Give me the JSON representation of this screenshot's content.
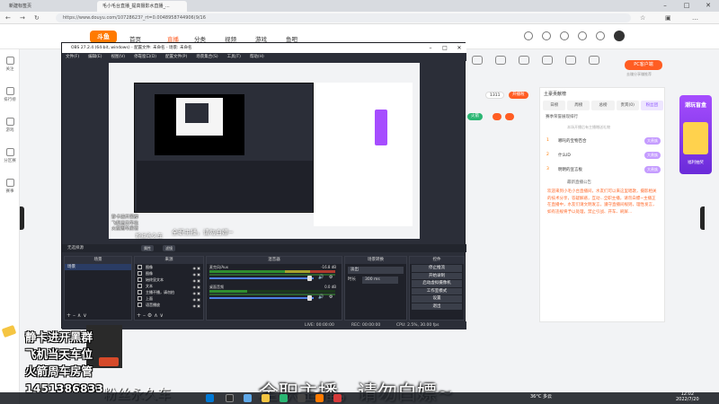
{
  "browser": {
    "tabs": [
      "新建标签页",
      "毛小毛台直播_提高摄影水直播_..."
    ],
    "url": "https://www.douyu.com/10728623?_rt=0.0048958744906(9/16"
  },
  "site": {
    "logo": "斗鱼",
    "nav": [
      "首页",
      "直播",
      "分类",
      "视频",
      "游戏",
      "鱼吧"
    ],
    "rail": [
      "关注",
      "排行榜",
      "游戏",
      "分区赛",
      "赛事"
    ],
    "room_actions": [
      "",
      "",
      "",
      "",
      "",
      "",
      ""
    ],
    "pc_button": "PC客户端",
    "pc_sub": "去赚分享赚推荐",
    "stat_num": "1311",
    "stat_pill": "开播啦",
    "fire": "火箭"
  },
  "rank": {
    "header": "土豪贡献榜",
    "tabs": [
      "日榜",
      "周榜",
      "总榜",
      "贵宾(0)",
      "粉丝团"
    ],
    "subtitle": "赛季荣誉展现排行",
    "subtitle2": "本场开播后有主播赠送礼物",
    "rows": [
      {
        "n": "1",
        "name": "哪吒的宝物百合",
        "tag": "大贵族"
      },
      {
        "n": "2",
        "name": "什么ID",
        "tag": "大贵族"
      },
      {
        "n": "3",
        "name": "明明的宣言板",
        "tag": "大贵族"
      }
    ],
    "notice_title": "最新直播公告",
    "notice": "欢迎来到小毛小台直播间，水友们可以来这里唱歌，摄影相关的技术分享，答疑解惑，互动...全职主播，请勿白嫖~主播正在直播中，水友们请文明发言，遵守直播间规则，理性发言，如有违规将予以处理，禁止引战、开车、刷屏..."
  },
  "ad": {
    "title": "潮玩盲盒",
    "sub": "福利抽奖"
  },
  "obs": {
    "title": "OBS 27.2.4 (64-bit, windows) - 配置文件: 未命名 - 场景: 未命名",
    "menu": [
      "文件(F)",
      "编辑(E)",
      "视图(V)",
      "停靠窗口(D)",
      "配置文件(P)",
      "场景集合(S)",
      "工具(T)",
      "帮助(H)"
    ],
    "underbar": "无选择源",
    "props_btn": "属性",
    "filter_btn": "滤镜",
    "docks": {
      "scenes": "场景",
      "sources": "来源",
      "mixer": "混音器",
      "transitions": "场景转换",
      "controls": "控件"
    },
    "scene_items": [
      "场景"
    ],
    "source_items": [
      "图像",
      "图像",
      "始终显文本",
      "文本",
      "主播不播，请勿拍",
      "上面",
      "语音播放"
    ],
    "mixer": [
      {
        "name": "麦克风/Aux",
        "db": "-16.8 dB"
      },
      {
        "name": "桌面音频",
        "db": "0.0 dB"
      }
    ],
    "transition": {
      "type": "淡出",
      "duration_label": "时长",
      "duration": "300 ms"
    },
    "controls": [
      "停止推流",
      "开始录制",
      "启动虚拟摄像机",
      "工作室模式",
      "设置",
      "退出"
    ],
    "status": {
      "live": "LIVE: 00:00:00",
      "rec": "REC: 00:00:00",
      "cpu": "CPU: 2.5%, 30.00 fps"
    }
  },
  "nested": {
    "overlay_lines": [
      "静卡进开黑群",
      "飞机当天车位",
      "火箭周车房管"
    ],
    "caption": "全职主播，请勿白嫖~",
    "caption_left": "粉丝永久车"
  },
  "overlay": {
    "lines": [
      "静卡进开黑群",
      "飞机当天车位",
      "火箭周车房管",
      "1451386833"
    ],
    "caption": "全职主播，请勿白嫖~",
    "caption_left": "粉丝永久车"
  },
  "taskbar": {
    "weather": "36°C 多云",
    "time": "12:02",
    "date": "2022/7/20"
  }
}
